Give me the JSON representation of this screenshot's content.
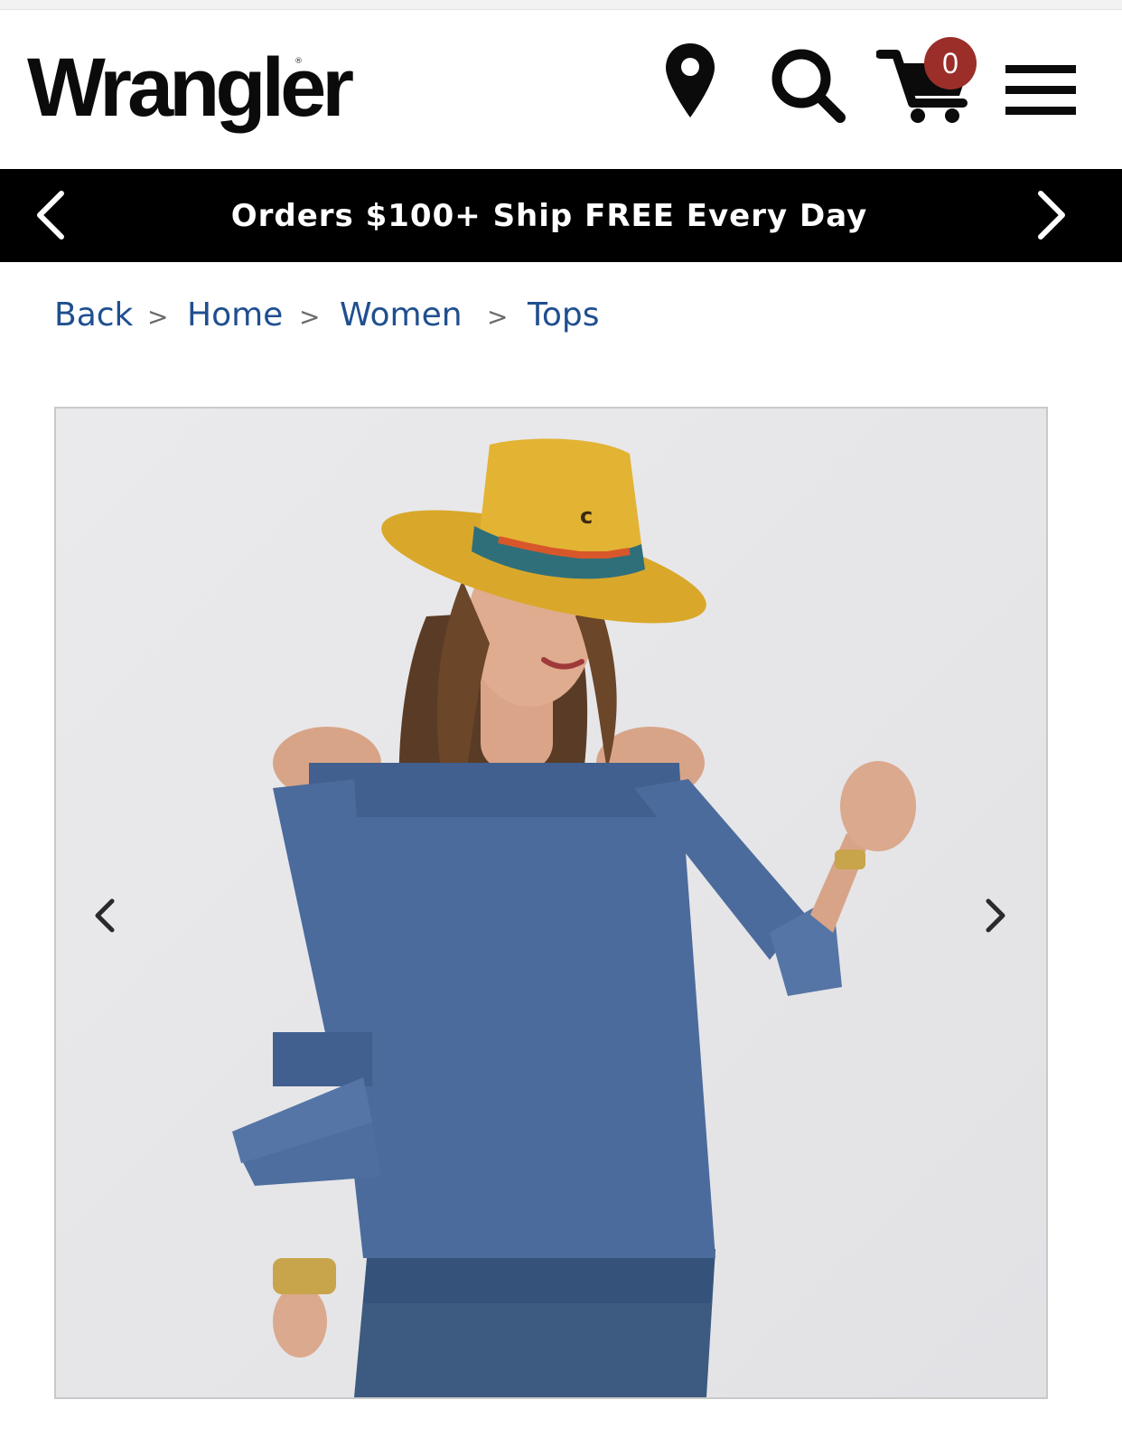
{
  "brand": {
    "logo_text": "Wrangler",
    "registered_mark": "®"
  },
  "header": {
    "icons": [
      "location-pin-icon",
      "search-icon",
      "cart-icon",
      "hamburger-menu-icon"
    ],
    "cart_count": "0",
    "cart_badge_color": "#9b2e29"
  },
  "promo": {
    "text": "Orders $100+ Ship FREE Every Day",
    "background": "#000000"
  },
  "breadcrumb": {
    "items": [
      "Back",
      "Home",
      "Women",
      "Tops"
    ],
    "separator": ">",
    "link_color": "#1f4f8f"
  },
  "product_image": {
    "subject": "woman in mustard hat and blue off-shoulder top",
    "prev_icon": "chevron-left-icon",
    "next_icon": "chevron-right-icon"
  }
}
